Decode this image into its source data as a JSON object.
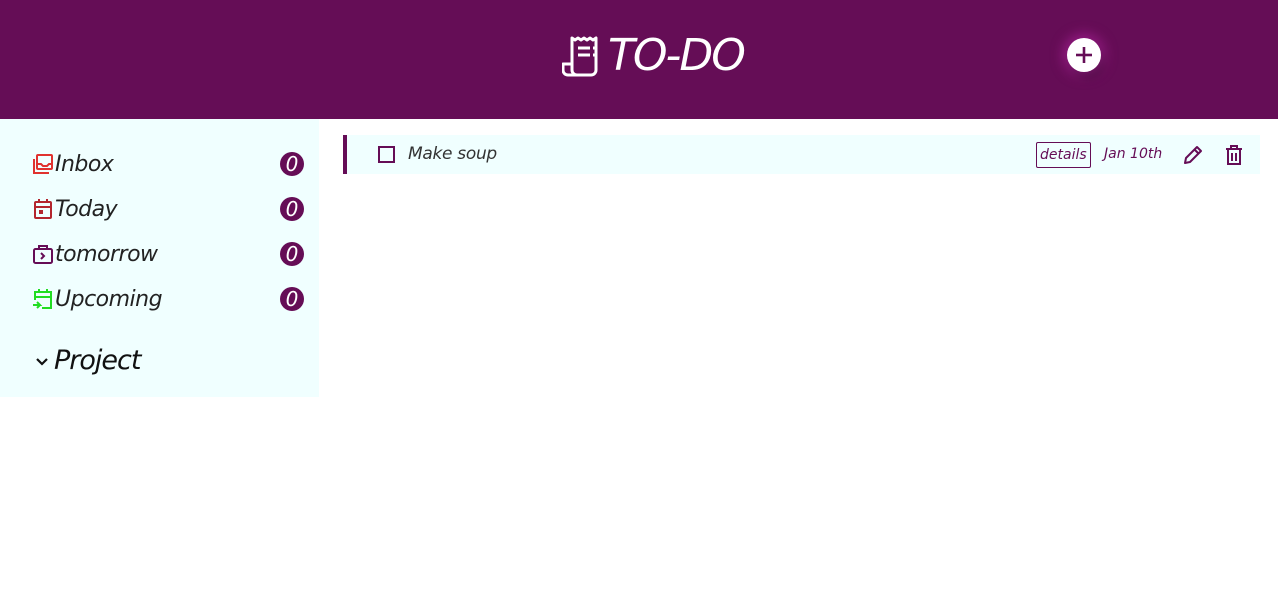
{
  "header": {
    "title": "TO-DO",
    "brand_icon": "receipt-icon",
    "add_icon": "plus-circle-icon",
    "background": "#650d56"
  },
  "sidebar": {
    "items": [
      {
        "label": "Inbox",
        "count": "0",
        "icon": "inbox-icon",
        "icon_color": "#e0322f"
      },
      {
        "label": "Today",
        "count": "0",
        "icon": "calendar-today-icon",
        "icon_color": "#b3262e"
      },
      {
        "label": "tomorrow",
        "count": "0",
        "icon": "calendar-next-icon",
        "icon_color": "#650d56"
      },
      {
        "label": "Upcoming",
        "count": "0",
        "icon": "calendar-upcoming-icon",
        "icon_color": "#22dd22"
      }
    ],
    "project": {
      "label": "Project",
      "icon": "chevron-down-icon"
    }
  },
  "tasks": [
    {
      "title": "Make soup",
      "details_label": "details",
      "date": "Jan 10th",
      "edit_icon": "pencil-icon",
      "delete_icon": "trash-icon"
    }
  ],
  "colors": {
    "accent": "#650d56",
    "panel": "#f0ffff"
  }
}
